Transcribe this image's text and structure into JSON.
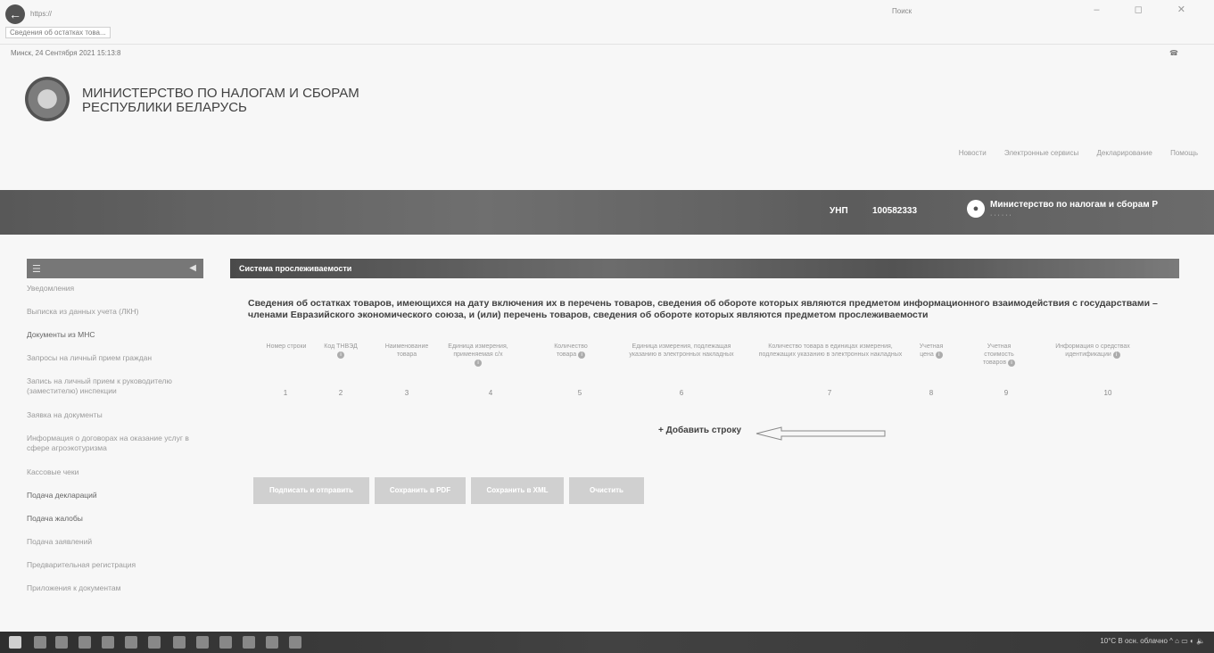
{
  "browser": {
    "url": "https://",
    "search_placeholder": "Поиск",
    "tab_title": "Сведения об остатках това...",
    "win_controls": "–  ◻  ✕"
  },
  "datetime": "Минск, 24 Сентября 2021 15:13:8",
  "header": {
    "title_line1": "МИНИСТЕРСТВО ПО НАЛОГАМ И СБОРАМ",
    "title_line2": "РЕСПУБЛИКИ БЕЛАРУСЬ",
    "nav": [
      "Новости",
      "Электронные сервисы",
      "Декларирование",
      "Помощь"
    ]
  },
  "topbar": {
    "unp_label": "УНП",
    "unp_value": "100582333",
    "user_name": "Министерство по налогам и сборам Р"
  },
  "sidebar": {
    "items": [
      "Уведомления",
      "Выписка из данных учета (ЛКН)",
      "Документы из МНС",
      "Запросы на личный прием граждан",
      "Запись на личный прием к руководителю (заместителю) инспекции",
      "Заявка на документы",
      "Информация о договорах на оказание услуг в сфере агроэкотуризма",
      "Кассовые чеки",
      "Подача деклараций",
      "Подача жалобы",
      "Подача заявлений",
      "Предварительная регистрация",
      "Приложения к документам"
    ]
  },
  "main": {
    "panel_title": "Система прослеживаемости",
    "description": "Сведения об остатках товаров, имеющихся на дату включения их в перечень товаров, сведения об обороте которых являются предметом информационного взаимодействия с государствами – членами Евразийского экономического союза, и (или) перечень товаров, сведения об обороте которых являются предметом прослеживаемости",
    "columns": [
      "Номер строки",
      "Код ТНВЭД",
      "Наименование товара",
      "Единица измерения, применяемая с/х",
      "Количество товара",
      "Единица измерения, подлежащая указанию в электронных накладных",
      "Количество товара в единицах измерения, подлежащих указанию в электронных накладных",
      "Учетная цена",
      "Учетная стоимость товаров",
      "Информация о средствах идентификации"
    ],
    "column_numbers": [
      "1",
      "2",
      "3",
      "4",
      "5",
      "6",
      "7",
      "8",
      "9",
      "10"
    ],
    "add_row_label": "+ Добавить строку",
    "buttons": [
      "Подписать и отправить",
      "Сохранить в PDF",
      "Сохранить в XML",
      "Очистить"
    ]
  },
  "taskbar": {
    "tray_text": "10°C В осн. облачно"
  }
}
